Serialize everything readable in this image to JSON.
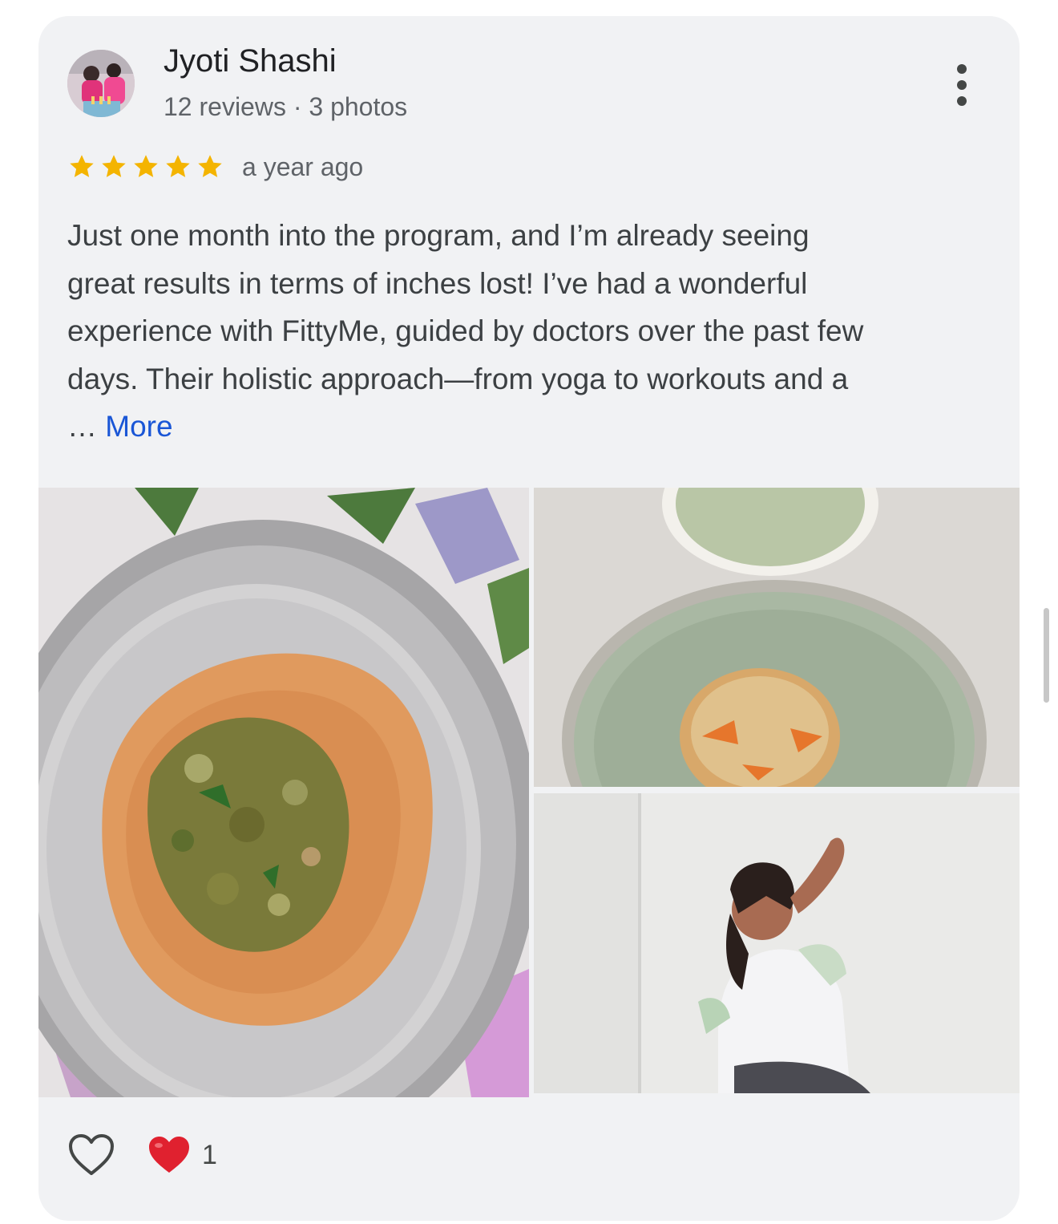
{
  "review": {
    "reviewer_name": "Jyoti Shashi",
    "reviewer_meta": "12 reviews · 3 photos",
    "rating": 5,
    "rating_max": 5,
    "date": "a year ago",
    "text_lines": [
      "Just one month into the program, and I’m already seeing",
      "great results in terms of inches lost! I’ve had a wonderful",
      "experience with FittyMe, guided by doctors over the past few",
      "days. Their holistic approach—from yoga to workouts and a"
    ],
    "ellipsis": "… ",
    "more_label": "More"
  },
  "reactions": {
    "count": "1"
  },
  "colors": {
    "card_background": "#f1f2f4",
    "star": "#f4b400",
    "link": "#1a56d6",
    "heart": "#e0212f"
  },
  "icons": {
    "more": "more-vertical-icon",
    "like": "heart-outline-icon",
    "reaction": "red-heart-icon",
    "star": "star-icon"
  }
}
